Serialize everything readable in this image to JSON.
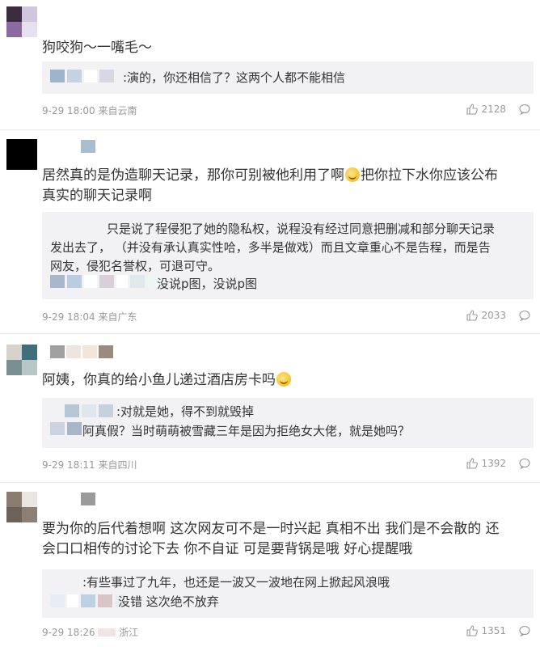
{
  "comments": [
    {
      "text": "狗咬狗～一嘴毛～",
      "replies": [
        ":演的，你还相信了？这两个人都不能相信"
      ],
      "time": "9-29 18:00 来自云南",
      "likes": "2128"
    },
    {
      "text_part1": "居然真的是伪造聊天记录，那你可别被他利用了啊",
      "text_part2": "把你拉下水你应该公布",
      "text_line2": "真实的聊天记录啊",
      "reply_lines": [
        "只是说了程侵犯了她的隐私权，说程没有经过同意把删减和部分聊天记录",
        "发出去了， （并没有承认真实性哈，多半是做戏）而且文章重心不是告程，而是告",
        "网友，侵犯名誉权，可退可守。",
        "没说p图，没说p图"
      ],
      "time": "9-29 18:04 来自广东",
      "likes": "2033"
    },
    {
      "text": "阿姨，你真的给小鱼儿递过酒店房卡吗",
      "replies": [
        ":对就是她，得不到就毁掉",
        "阿真假？当时萌萌被雪藏三年是因为拒绝女大佬，就是她吗？"
      ],
      "time": "9-29 18:11 来自四川",
      "likes": "1392"
    },
    {
      "text_line1": "要为你的后代着想啊 这次网友可不是一时兴起 真相不出 我们是不会散的 还",
      "text_line2": "会口口相传的讨论下去 你不自证 可是要背锅是哦 好心提醒哦",
      "replies": [
        ":有些事过了九年，也还是一波又一波地在网上掀起风浪哦",
        "没错 这次绝不放弃"
      ],
      "time_part1": "9-29 18:26",
      "time_part2": "浙江",
      "likes": "1351"
    }
  ],
  "icons": {
    "like": "thumbs-up-icon",
    "comment": "comment-bubble-icon",
    "emoji": "emoji-icon"
  },
  "colors": {
    "meta": "#999999",
    "reply_bg": "#f2f2f5",
    "text": "#333333"
  }
}
